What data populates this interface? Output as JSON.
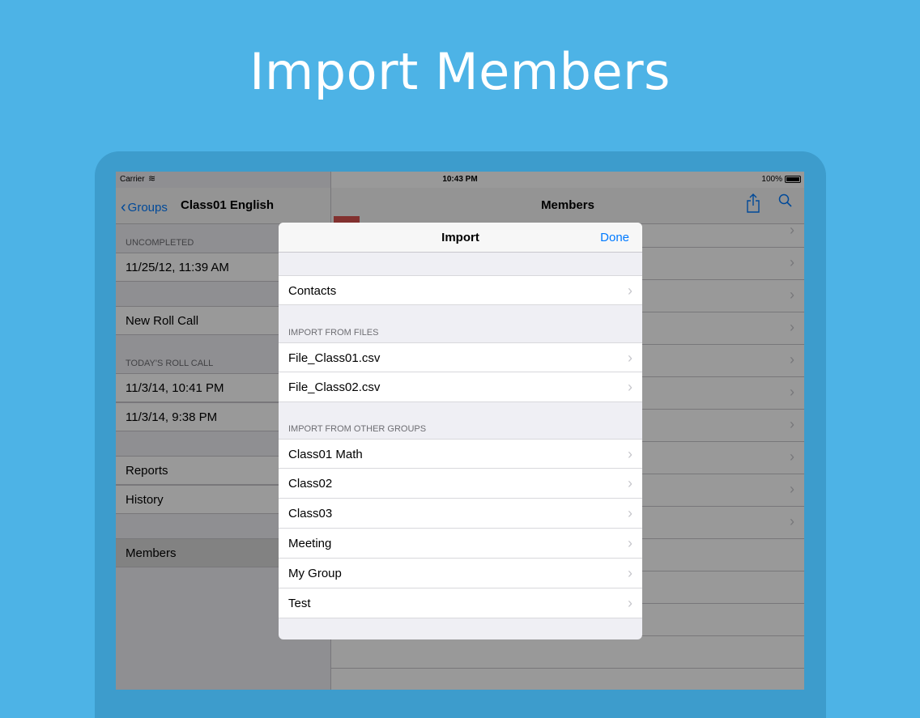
{
  "hero_title": "Import Members",
  "status_bar": {
    "carrier": "Carrier",
    "time": "10:43 PM",
    "battery": "100%"
  },
  "master": {
    "back_label": "Groups",
    "title": "Class01 English",
    "uncompleted_header": "UNCOMPLETED",
    "uncompleted_item": "11/25/12, 11:39 AM",
    "new_roll_call": "New Roll Call",
    "today_header": "TODAY'S ROLL CALL",
    "today_items": [
      "11/3/14, 10:41 PM",
      "11/3/14, 9:38 PM"
    ],
    "reports": "Reports",
    "history": "History",
    "members": "Members"
  },
  "detail": {
    "title": "Members"
  },
  "modal": {
    "title": "Import",
    "done": "Done",
    "contacts": "Contacts",
    "files_header": "IMPORT FROM FILES",
    "files": [
      "File_Class01.csv",
      "File_Class02.csv"
    ],
    "groups_header": "IMPORT FROM OTHER GROUPS",
    "groups": [
      "Class01 Math",
      "Class02",
      "Class03",
      "Meeting",
      "My Group",
      "Test"
    ]
  },
  "icons": {
    "back": "chevron-left-icon",
    "share": "share-icon",
    "search": "search-icon",
    "disclosure": "chevron-right-icon"
  }
}
